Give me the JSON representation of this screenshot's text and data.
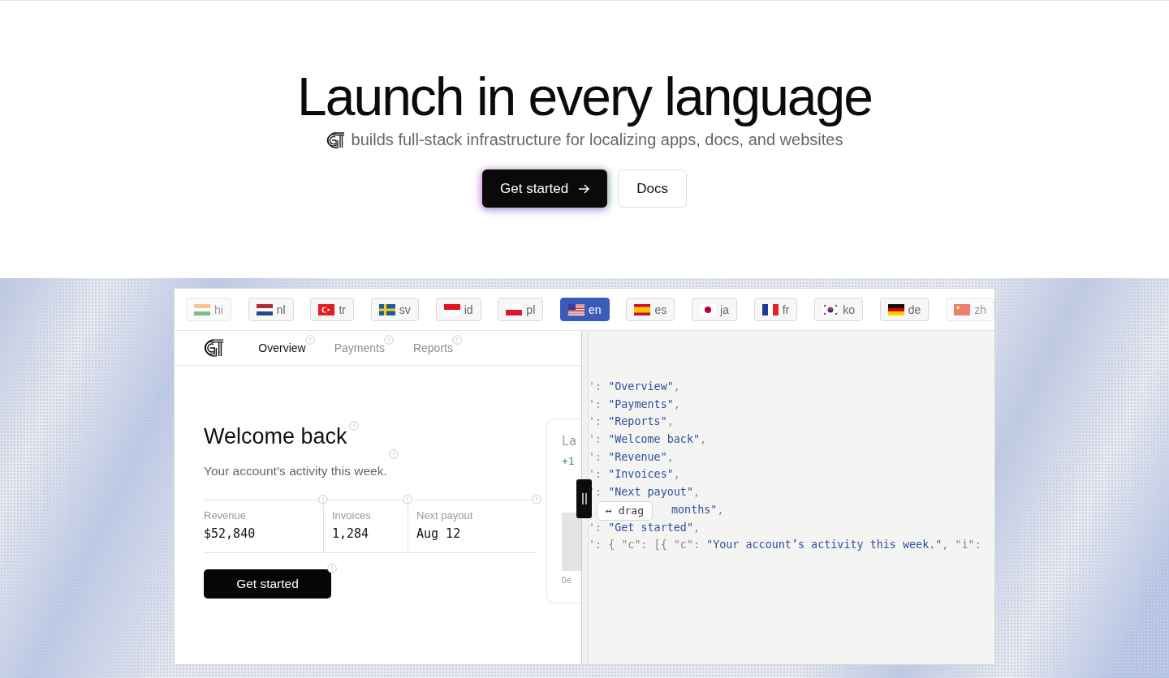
{
  "hero": {
    "title": "Launch in every language",
    "subtitle": "builds full-stack infrastructure for localizing apps, docs, and websites",
    "buttons": [
      {
        "kind": "primary",
        "label": "Get started"
      },
      {
        "kind": "secondary",
        "label": "Docs"
      }
    ]
  },
  "languages": [
    {
      "code": "hi",
      "kind": "india",
      "selected": false,
      "faded": true
    },
    {
      "code": "nl",
      "kind": "netherlands",
      "selected": false,
      "faded": false
    },
    {
      "code": "tr",
      "kind": "turkey",
      "selected": false,
      "faded": false
    },
    {
      "code": "sv",
      "kind": "sweden",
      "selected": false,
      "faded": false
    },
    {
      "code": "id",
      "kind": "indonesia",
      "selected": false,
      "faded": false
    },
    {
      "code": "pl",
      "kind": "poland",
      "selected": false,
      "faded": false
    },
    {
      "code": "en",
      "kind": "usa",
      "selected": true,
      "faded": false
    },
    {
      "code": "es",
      "kind": "spain",
      "selected": false,
      "faded": false
    },
    {
      "code": "ja",
      "kind": "japan",
      "selected": false,
      "faded": false
    },
    {
      "code": "fr",
      "kind": "france",
      "selected": false,
      "faded": false
    },
    {
      "code": "ko",
      "kind": "korea",
      "selected": false,
      "faded": false
    },
    {
      "code": "de",
      "kind": "germany",
      "selected": false,
      "faded": false
    },
    {
      "code": "zh",
      "kind": "china",
      "selected": false,
      "faded": true
    }
  ],
  "app": {
    "nav": [
      {
        "label": "Overview",
        "selected": true
      },
      {
        "label": "Payments",
        "selected": false
      },
      {
        "label": "Reports",
        "selected": false
      }
    ],
    "title": "Welcome back",
    "subtitle": "Your account’s activity this week.",
    "stats": [
      {
        "label": "Revenue",
        "value": "$52,840"
      },
      {
        "label": "Invoices",
        "value": "1,284"
      },
      {
        "label": "Next payout",
        "value": "Aug 12"
      }
    ],
    "button": "Get started",
    "chart_card": {
      "title": "La",
      "delta": "+1",
      "axis_label": "De"
    }
  },
  "drag_tooltip": "↔ drag",
  "code_lines": [
    {
      "prefix": "': ",
      "value": "\"Overview\"",
      "suffix": ",",
      "covered": false
    },
    {
      "prefix": "': ",
      "value": "\"Payments\"",
      "suffix": ",",
      "covered": false
    },
    {
      "prefix": "': ",
      "value": "\"Reports\"",
      "suffix": ",",
      "covered": false
    },
    {
      "prefix": "': ",
      "value": "\"Welcome back\"",
      "suffix": ",",
      "covered": false
    },
    {
      "prefix": "': ",
      "value": "\"Revenue\"",
      "suffix": ",",
      "covered": false
    },
    {
      "prefix": "': ",
      "value": "\"Invoices\"",
      "suffix": ",",
      "covered": false
    },
    {
      "prefix": "': ",
      "value": "\"Next payout\"",
      "suffix": ",",
      "covered": false
    },
    {
      "value": "months\"",
      "suffix": ",",
      "covered": true
    },
    {
      "prefix": "': ",
      "value": "\"Get started\"",
      "suffix": ",",
      "covered": false
    },
    {
      "prefix": "': { \"c\": [{ \"c\": ",
      "value": "\"Your account’s activity this week.\"",
      "suffix": ", \"i\":",
      "covered": false
    }
  ]
}
